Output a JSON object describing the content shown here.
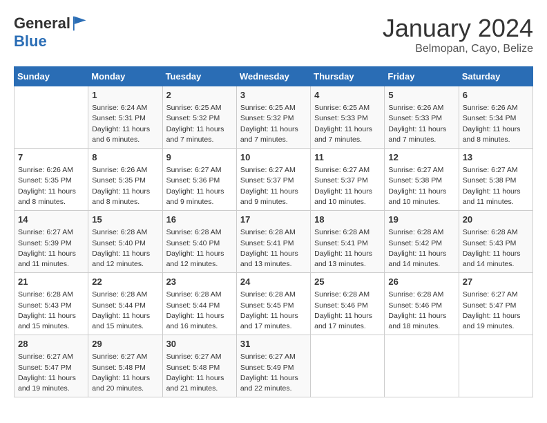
{
  "logo": {
    "general": "General",
    "blue": "Blue"
  },
  "title": "January 2024",
  "location": "Belmopan, Cayo, Belize",
  "days_of_week": [
    "Sunday",
    "Monday",
    "Tuesday",
    "Wednesday",
    "Thursday",
    "Friday",
    "Saturday"
  ],
  "weeks": [
    [
      {
        "day": "",
        "info": ""
      },
      {
        "day": "1",
        "info": "Sunrise: 6:24 AM\nSunset: 5:31 PM\nDaylight: 11 hours\nand 6 minutes."
      },
      {
        "day": "2",
        "info": "Sunrise: 6:25 AM\nSunset: 5:32 PM\nDaylight: 11 hours\nand 7 minutes."
      },
      {
        "day": "3",
        "info": "Sunrise: 6:25 AM\nSunset: 5:32 PM\nDaylight: 11 hours\nand 7 minutes."
      },
      {
        "day": "4",
        "info": "Sunrise: 6:25 AM\nSunset: 5:33 PM\nDaylight: 11 hours\nand 7 minutes."
      },
      {
        "day": "5",
        "info": "Sunrise: 6:26 AM\nSunset: 5:33 PM\nDaylight: 11 hours\nand 7 minutes."
      },
      {
        "day": "6",
        "info": "Sunrise: 6:26 AM\nSunset: 5:34 PM\nDaylight: 11 hours\nand 8 minutes."
      }
    ],
    [
      {
        "day": "7",
        "info": "Sunrise: 6:26 AM\nSunset: 5:35 PM\nDaylight: 11 hours\nand 8 minutes."
      },
      {
        "day": "8",
        "info": "Sunrise: 6:26 AM\nSunset: 5:35 PM\nDaylight: 11 hours\nand 8 minutes."
      },
      {
        "day": "9",
        "info": "Sunrise: 6:27 AM\nSunset: 5:36 PM\nDaylight: 11 hours\nand 9 minutes."
      },
      {
        "day": "10",
        "info": "Sunrise: 6:27 AM\nSunset: 5:37 PM\nDaylight: 11 hours\nand 9 minutes."
      },
      {
        "day": "11",
        "info": "Sunrise: 6:27 AM\nSunset: 5:37 PM\nDaylight: 11 hours\nand 10 minutes."
      },
      {
        "day": "12",
        "info": "Sunrise: 6:27 AM\nSunset: 5:38 PM\nDaylight: 11 hours\nand 10 minutes."
      },
      {
        "day": "13",
        "info": "Sunrise: 6:27 AM\nSunset: 5:38 PM\nDaylight: 11 hours\nand 11 minutes."
      }
    ],
    [
      {
        "day": "14",
        "info": "Sunrise: 6:27 AM\nSunset: 5:39 PM\nDaylight: 11 hours\nand 11 minutes."
      },
      {
        "day": "15",
        "info": "Sunrise: 6:28 AM\nSunset: 5:40 PM\nDaylight: 11 hours\nand 12 minutes."
      },
      {
        "day": "16",
        "info": "Sunrise: 6:28 AM\nSunset: 5:40 PM\nDaylight: 11 hours\nand 12 minutes."
      },
      {
        "day": "17",
        "info": "Sunrise: 6:28 AM\nSunset: 5:41 PM\nDaylight: 11 hours\nand 13 minutes."
      },
      {
        "day": "18",
        "info": "Sunrise: 6:28 AM\nSunset: 5:41 PM\nDaylight: 11 hours\nand 13 minutes."
      },
      {
        "day": "19",
        "info": "Sunrise: 6:28 AM\nSunset: 5:42 PM\nDaylight: 11 hours\nand 14 minutes."
      },
      {
        "day": "20",
        "info": "Sunrise: 6:28 AM\nSunset: 5:43 PM\nDaylight: 11 hours\nand 14 minutes."
      }
    ],
    [
      {
        "day": "21",
        "info": "Sunrise: 6:28 AM\nSunset: 5:43 PM\nDaylight: 11 hours\nand 15 minutes."
      },
      {
        "day": "22",
        "info": "Sunrise: 6:28 AM\nSunset: 5:44 PM\nDaylight: 11 hours\nand 15 minutes."
      },
      {
        "day": "23",
        "info": "Sunrise: 6:28 AM\nSunset: 5:44 PM\nDaylight: 11 hours\nand 16 minutes."
      },
      {
        "day": "24",
        "info": "Sunrise: 6:28 AM\nSunset: 5:45 PM\nDaylight: 11 hours\nand 17 minutes."
      },
      {
        "day": "25",
        "info": "Sunrise: 6:28 AM\nSunset: 5:46 PM\nDaylight: 11 hours\nand 17 minutes."
      },
      {
        "day": "26",
        "info": "Sunrise: 6:28 AM\nSunset: 5:46 PM\nDaylight: 11 hours\nand 18 minutes."
      },
      {
        "day": "27",
        "info": "Sunrise: 6:27 AM\nSunset: 5:47 PM\nDaylight: 11 hours\nand 19 minutes."
      }
    ],
    [
      {
        "day": "28",
        "info": "Sunrise: 6:27 AM\nSunset: 5:47 PM\nDaylight: 11 hours\nand 19 minutes."
      },
      {
        "day": "29",
        "info": "Sunrise: 6:27 AM\nSunset: 5:48 PM\nDaylight: 11 hours\nand 20 minutes."
      },
      {
        "day": "30",
        "info": "Sunrise: 6:27 AM\nSunset: 5:48 PM\nDaylight: 11 hours\nand 21 minutes."
      },
      {
        "day": "31",
        "info": "Sunrise: 6:27 AM\nSunset: 5:49 PM\nDaylight: 11 hours\nand 22 minutes."
      },
      {
        "day": "",
        "info": ""
      },
      {
        "day": "",
        "info": ""
      },
      {
        "day": "",
        "info": ""
      }
    ]
  ]
}
